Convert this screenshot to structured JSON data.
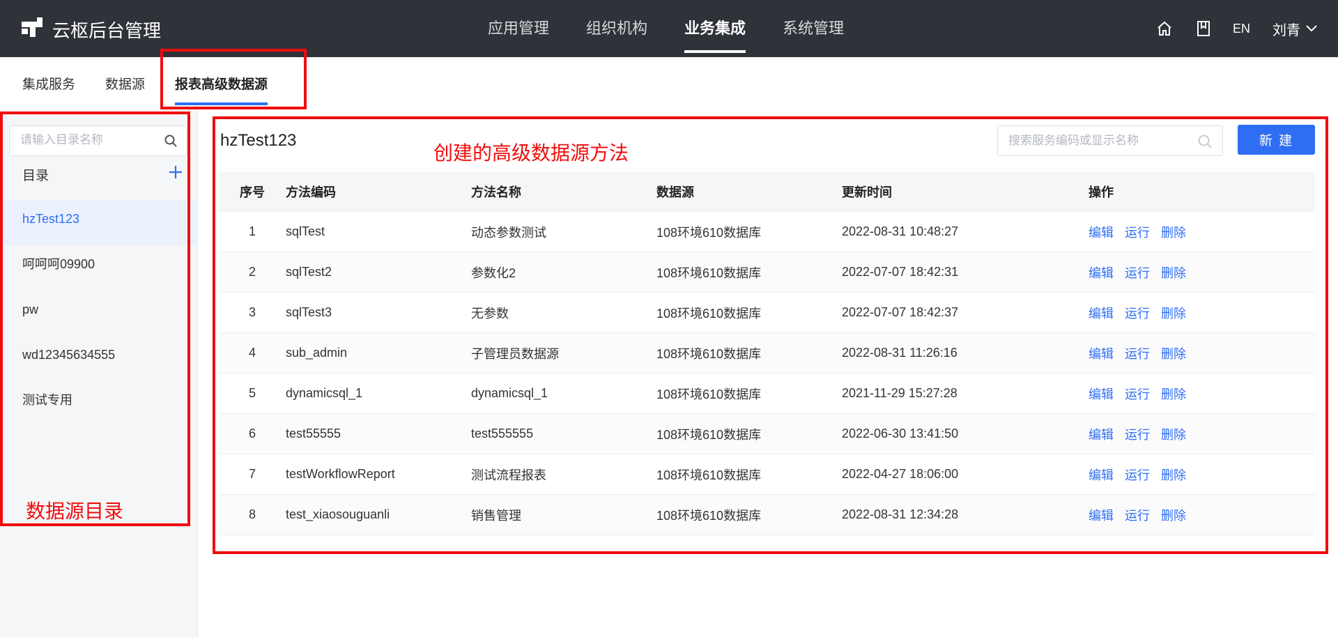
{
  "header": {
    "title": "云枢后台管理",
    "nav": [
      {
        "label": "应用管理",
        "active": false
      },
      {
        "label": "组织机构",
        "active": false
      },
      {
        "label": "业务集成",
        "active": true
      },
      {
        "label": "系统管理",
        "active": false
      }
    ],
    "lang": "EN",
    "user": "刘青",
    "icons": [
      "home-icon",
      "book-icon",
      "chevron-down-icon"
    ]
  },
  "subtabs": [
    {
      "label": "集成服务",
      "active": false
    },
    {
      "label": "数据源",
      "active": false
    },
    {
      "label": "报表高级数据源",
      "active": true
    }
  ],
  "sidebar": {
    "search_placeholder": "请输入目录名称",
    "dir_header": "目录",
    "items": [
      {
        "label": "hzTest123",
        "active": true
      },
      {
        "label": "呵呵呵09900",
        "active": false
      },
      {
        "label": "pw",
        "active": false
      },
      {
        "label": "wd12345634555",
        "active": false
      },
      {
        "label": "测试专用",
        "active": false
      }
    ]
  },
  "main": {
    "title": "hzTest123",
    "search_placeholder": "搜索服务编码或显示名称",
    "new_button": "新 建",
    "columns": {
      "no": "序号",
      "code": "方法编码",
      "name": "方法名称",
      "datasource": "数据源",
      "updated": "更新时间",
      "ops": "操作"
    },
    "ops": {
      "edit": "编辑",
      "run": "运行",
      "delete": "删除"
    },
    "rows": [
      {
        "no": "1",
        "code": "sqlTest",
        "name": "动态参数测试",
        "datasource": "108环境610数据库",
        "updated": "2022-08-31 10:48:27"
      },
      {
        "no": "2",
        "code": "sqlTest2",
        "name": "参数化2",
        "datasource": "108环境610数据库",
        "updated": "2022-07-07 18:42:31"
      },
      {
        "no": "3",
        "code": "sqlTest3",
        "name": "无参数",
        "datasource": "108环境610数据库",
        "updated": "2022-07-07 18:42:37"
      },
      {
        "no": "4",
        "code": "sub_admin",
        "name": "子管理员数据源",
        "datasource": "108环境610数据库",
        "updated": "2022-08-31 11:26:16"
      },
      {
        "no": "5",
        "code": "dynamicsql_1",
        "name": "dynamicsql_1",
        "datasource": "108环境610数据库",
        "updated": "2021-11-29 15:27:28"
      },
      {
        "no": "6",
        "code": "test55555",
        "name": "test555555",
        "datasource": "108环境610数据库",
        "updated": "2022-06-30 13:41:50"
      },
      {
        "no": "7",
        "code": "testWorkflowReport",
        "name": "测试流程报表",
        "datasource": "108环境610数据库",
        "updated": "2022-04-27 18:06:00"
      },
      {
        "no": "8",
        "code": "test_xiaosouguanli",
        "name": "销售管理",
        "datasource": "108环境610数据库",
        "updated": "2022-08-31 12:34:28"
      }
    ]
  },
  "annotations": {
    "method_label": "创建的高级数据源方法",
    "directory_label": "数据源目录",
    "color": "#f00d0d"
  },
  "colors": {
    "accent": "#2f6ef3",
    "topbar": "#2f3238"
  }
}
